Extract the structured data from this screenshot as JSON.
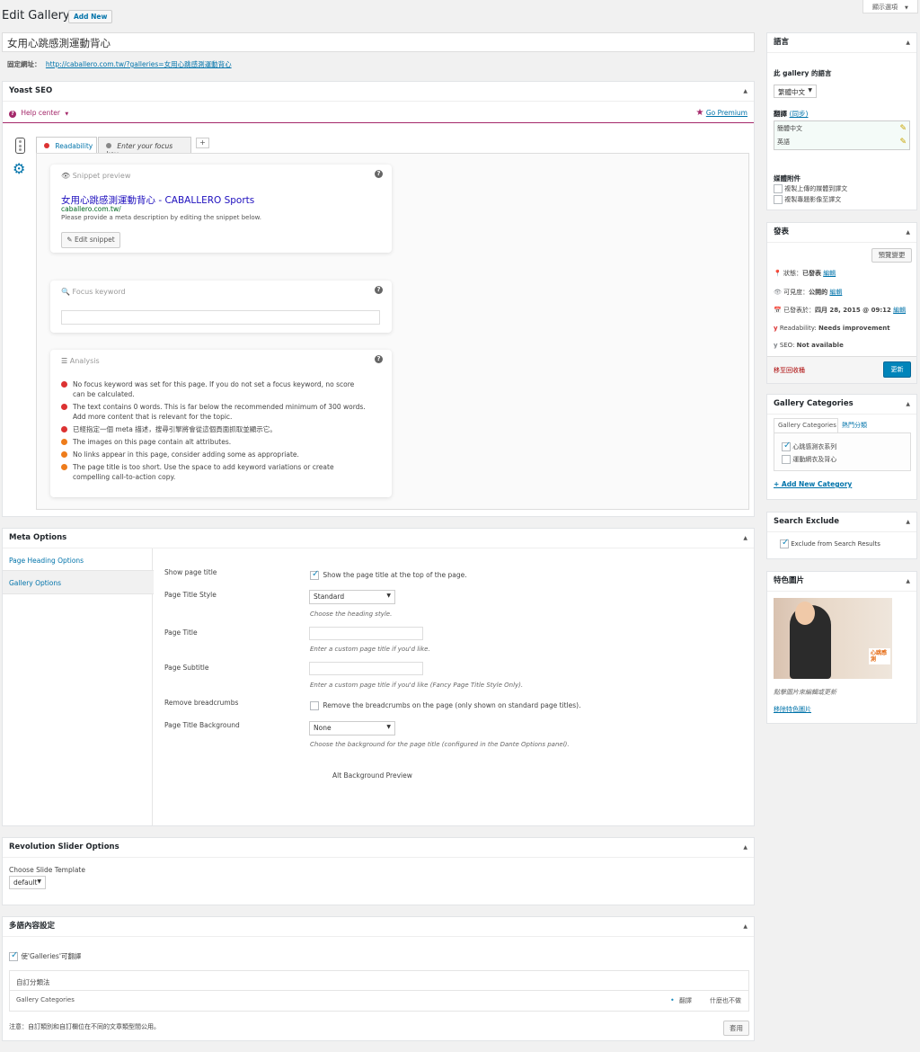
{
  "header": {
    "title": "Edit Gallery",
    "add_new": "Add New",
    "screen_options": "顯示選項"
  },
  "post": {
    "title": "女用心跳感測運動背心",
    "permalink_label": "固定網址：",
    "permalink_url": "http://caballero.com.tw/?galleries=女用心跳感測運動背心"
  },
  "yoast": {
    "title": "Yoast SEO",
    "help_center": "Help center",
    "go_premium": "Go Premium",
    "tab_readability": "Readability",
    "tab_keyword": "Enter your focus key...",
    "tab_add": "+",
    "snippet": {
      "heading": "Snippet preview",
      "title": "女用心跳感測運動背心 - CABALLERO Sports",
      "url": "caballero.com.tw/",
      "desc": "Please provide a meta description by editing the snippet below.",
      "edit": "Edit snippet"
    },
    "focus": {
      "heading": "Focus keyword"
    },
    "analysis": {
      "heading": "Analysis",
      "items": [
        {
          "text": "No focus keyword was set for this page. If you do not set a focus keyword, no score can be calculated.",
          "color": "#dc3232"
        },
        {
          "text": "The text contains 0 words. This is far below the recommended minimum of 300 words. Add more content that is relevant for the topic.",
          "color": "#dc3232"
        },
        {
          "text": "已經指定一個 meta 描述，搜尋引擎將會從這個頁面抓取並顯示它。",
          "color": "#dc3232"
        },
        {
          "text": "The images on this page contain alt attributes.",
          "color": "#ee7c1b"
        },
        {
          "text": "No links appear in this page, consider adding some as appropriate.",
          "color": "#ee7c1b"
        },
        {
          "text": "The page title is too short. Use the space to add keyword variations or create compelling call-to-action copy.",
          "color": "#ee7c1b"
        }
      ]
    }
  },
  "meta": {
    "title": "Meta Options",
    "tabs": [
      "Page Heading Options",
      "Gallery Options"
    ],
    "show_title_label": "Show page title",
    "show_title_text": "Show the page title at the top of the page.",
    "style_label": "Page Title Style",
    "style_value": "Standard",
    "style_hint": "Choose the heading style.",
    "page_title_label": "Page Title",
    "page_title_hint": "Enter a custom page title if you'd like.",
    "subtitle_label": "Page Subtitle",
    "subtitle_hint": "Enter a custom page title if you'd like (Fancy Page Title Style Only).",
    "bc_label": "Remove breadcrumbs",
    "bc_text": "Remove the breadcrumbs on the page (only shown on standard page titles).",
    "bg_label": "Page Title Background",
    "bg_value": "None",
    "bg_hint": "Choose the background for the page title (configured in the Dante Options panel).",
    "alt_preview": "Alt Background Preview"
  },
  "rev": {
    "title": "Revolution Slider Options",
    "label": "Choose Slide Template",
    "value": "default"
  },
  "ml": {
    "title": "多語內容設定",
    "translatable": "使'Galleries'可翻譯",
    "custom_tax": "自訂分類法",
    "gallery_cat": "Gallery Categories",
    "opt_translate": "翻譯",
    "opt_nothing": "什麼也不做",
    "note": "注意：自訂類別和自訂欄位在不同的文章類型間公用。",
    "apply": "套用"
  },
  "lang": {
    "title": "語言",
    "post_lang_label": "此 gallery 的語言",
    "lang_value": "繁體中文",
    "translations": "翻譯",
    "sync": "(同步)",
    "rows": [
      "簡體中文",
      "英語"
    ],
    "media_title": "媒體附件",
    "media_opt1": "複製上傳的媒體到譯文",
    "media_opt2": "複製專題影像至譯文"
  },
  "publish": {
    "title": "發表",
    "preview": "預覽變更",
    "status_label": "狀態：",
    "status_value": "已發表",
    "visibility_label": "可見度：",
    "visibility_value": "公開的",
    "date_label": "已發表於：",
    "date_value": "四月 28, 2015 @ 09:12",
    "edit": "編輯",
    "readability_label": "Readability:",
    "readability_value": "Needs improvement",
    "seo_label": "SEO:",
    "seo_value": "Not available",
    "trash": "移至回收桶",
    "update": "更新"
  },
  "gcat": {
    "title": "Gallery Categories",
    "tab_all": "Gallery Categories",
    "tab_pop": "熱門分類",
    "cats": [
      "心跳感測衣系列",
      "運動網衣及背心"
    ],
    "add_new": "+ Add New Category"
  },
  "search_exclude": {
    "title": "Search Exclude",
    "label": "Exclude from Search Results"
  },
  "featured": {
    "title": "特色圖片",
    "hint": "點擊圖片來編輯或更新",
    "remove": "移除特色圖片",
    "img_text": "心跳感測"
  },
  "colors": {
    "accent": "#0073aa",
    "red": "#dc3232",
    "orange": "#ee7c1b",
    "yoast": "#a4286a"
  }
}
